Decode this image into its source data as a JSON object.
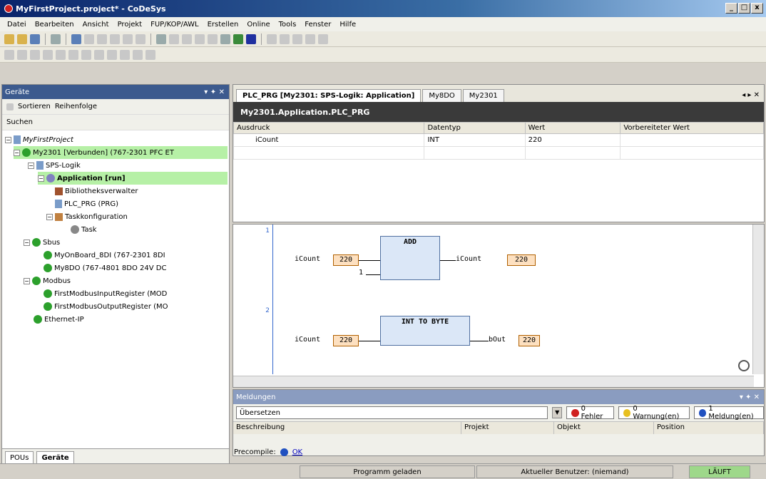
{
  "window": {
    "title": "MyFirstProject.project* - CoDeSys",
    "min": "_",
    "max": "□",
    "close": "x"
  },
  "menu": [
    "Datei",
    "Bearbeiten",
    "Ansicht",
    "Projekt",
    "FUP/KOP/AWL",
    "Erstellen",
    "Online",
    "Tools",
    "Fenster",
    "Hilfe"
  ],
  "devices": {
    "title": "Geräte",
    "pin": "▾ ✦ ✕",
    "sort_label": "Sortieren",
    "order_label": "Reihenfolge",
    "search_label": "Suchen",
    "tree": [
      {
        "label": "MyFirstProject",
        "italic": true
      },
      {
        "label": "My2301 [Verbunden] (767-2301 PFC ET",
        "highlight": true
      },
      {
        "label": "SPS-Logik"
      },
      {
        "label": "Application [run]",
        "bold": true,
        "highlight": true
      },
      {
        "label": "Bibliotheksverwalter"
      },
      {
        "label": "PLC_PRG (PRG)"
      },
      {
        "label": "Taskkonfiguration"
      },
      {
        "label": "Task"
      },
      {
        "label": "Sbus"
      },
      {
        "label": "MyOnBoard_8DI (767-2301 8DI"
      },
      {
        "label": "My8DO (767-4801 8DO 24V DC"
      },
      {
        "label": "Modbus"
      },
      {
        "label": "FirstModbusInputRegister (MOD"
      },
      {
        "label": "FirstModbusOutputRegister (MO"
      },
      {
        "label": "Ethernet-IP"
      }
    ],
    "tabs": [
      "POUs",
      "Geräte"
    ]
  },
  "editor": {
    "tabs": [
      "PLC_PRG [My2301: SPS-Logik: Application]",
      "My8DO",
      "My2301"
    ],
    "tab_controls": "◂ ▸ ✕",
    "breadcrumb": "My2301.Application.PLC_PRG",
    "columns": [
      "Ausdruck",
      "Datentyp",
      "Wert",
      "Vorbereiteter Wert"
    ],
    "rows": [
      {
        "expr": "iCount",
        "type": "INT",
        "value": "220",
        "prepared": ""
      }
    ]
  },
  "fbd": {
    "networks": [
      "1",
      "2"
    ],
    "block1": {
      "name": "ADD",
      "in1": "iCount",
      "in1val": "220",
      "in2": "1",
      "out": "iCount",
      "outval": "220"
    },
    "block2": {
      "name": "INT TO BYTE",
      "in1": "iCount",
      "in1val": "220",
      "out": "bOut",
      "outval": "220"
    }
  },
  "messages": {
    "title": "Meldungen",
    "controls": "▾ ✦ ✕",
    "filter": "Übersetzen",
    "errors": "0 Fehler",
    "warnings": "0 Warnung(en)",
    "infos": "1 Meldung(en)",
    "columns": [
      "Beschreibung",
      "Projekt",
      "Objekt",
      "Position"
    ]
  },
  "precompile": {
    "label": "Precompile:",
    "status": "OK"
  },
  "status": {
    "msg": "Programm geladen",
    "user": "Aktueller Benutzer: (niemand)",
    "state": "LÄUFT"
  },
  "colors": {
    "running": "#b6f0a6",
    "accent": "#0a246a"
  }
}
